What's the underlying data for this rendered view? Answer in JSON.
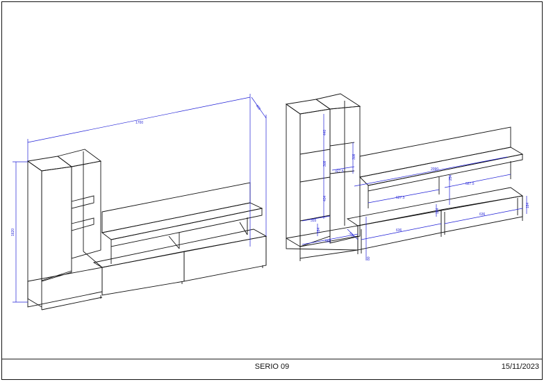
{
  "title_block": {
    "name": "SERIO 09",
    "date": "15/11/2023"
  },
  "colors": {
    "outline": "#111111",
    "dimension": "#1f1fd6"
  },
  "left_view": {
    "dims": {
      "width": "1700",
      "height": "1620",
      "depth": "400"
    }
  },
  "right_view": {
    "dims": {
      "tv_width": "2090",
      "tall_top": "440",
      "tall_mid": "308",
      "tall_low": "404",
      "side_top": "308",
      "small_w": "327.5",
      "small_h": "254",
      "shelf_left": "627.5",
      "shelf_right": "627.5",
      "shelf_mid_h": "254",
      "base_left_w": "355",
      "base_left_h": "184",
      "base_front": "568",
      "plinth": "80",
      "drawer_a": "636",
      "drawer_b": "636",
      "drawer_h_a": "184",
      "drawer_h_b": "184",
      "drawer_side": "356"
    }
  }
}
